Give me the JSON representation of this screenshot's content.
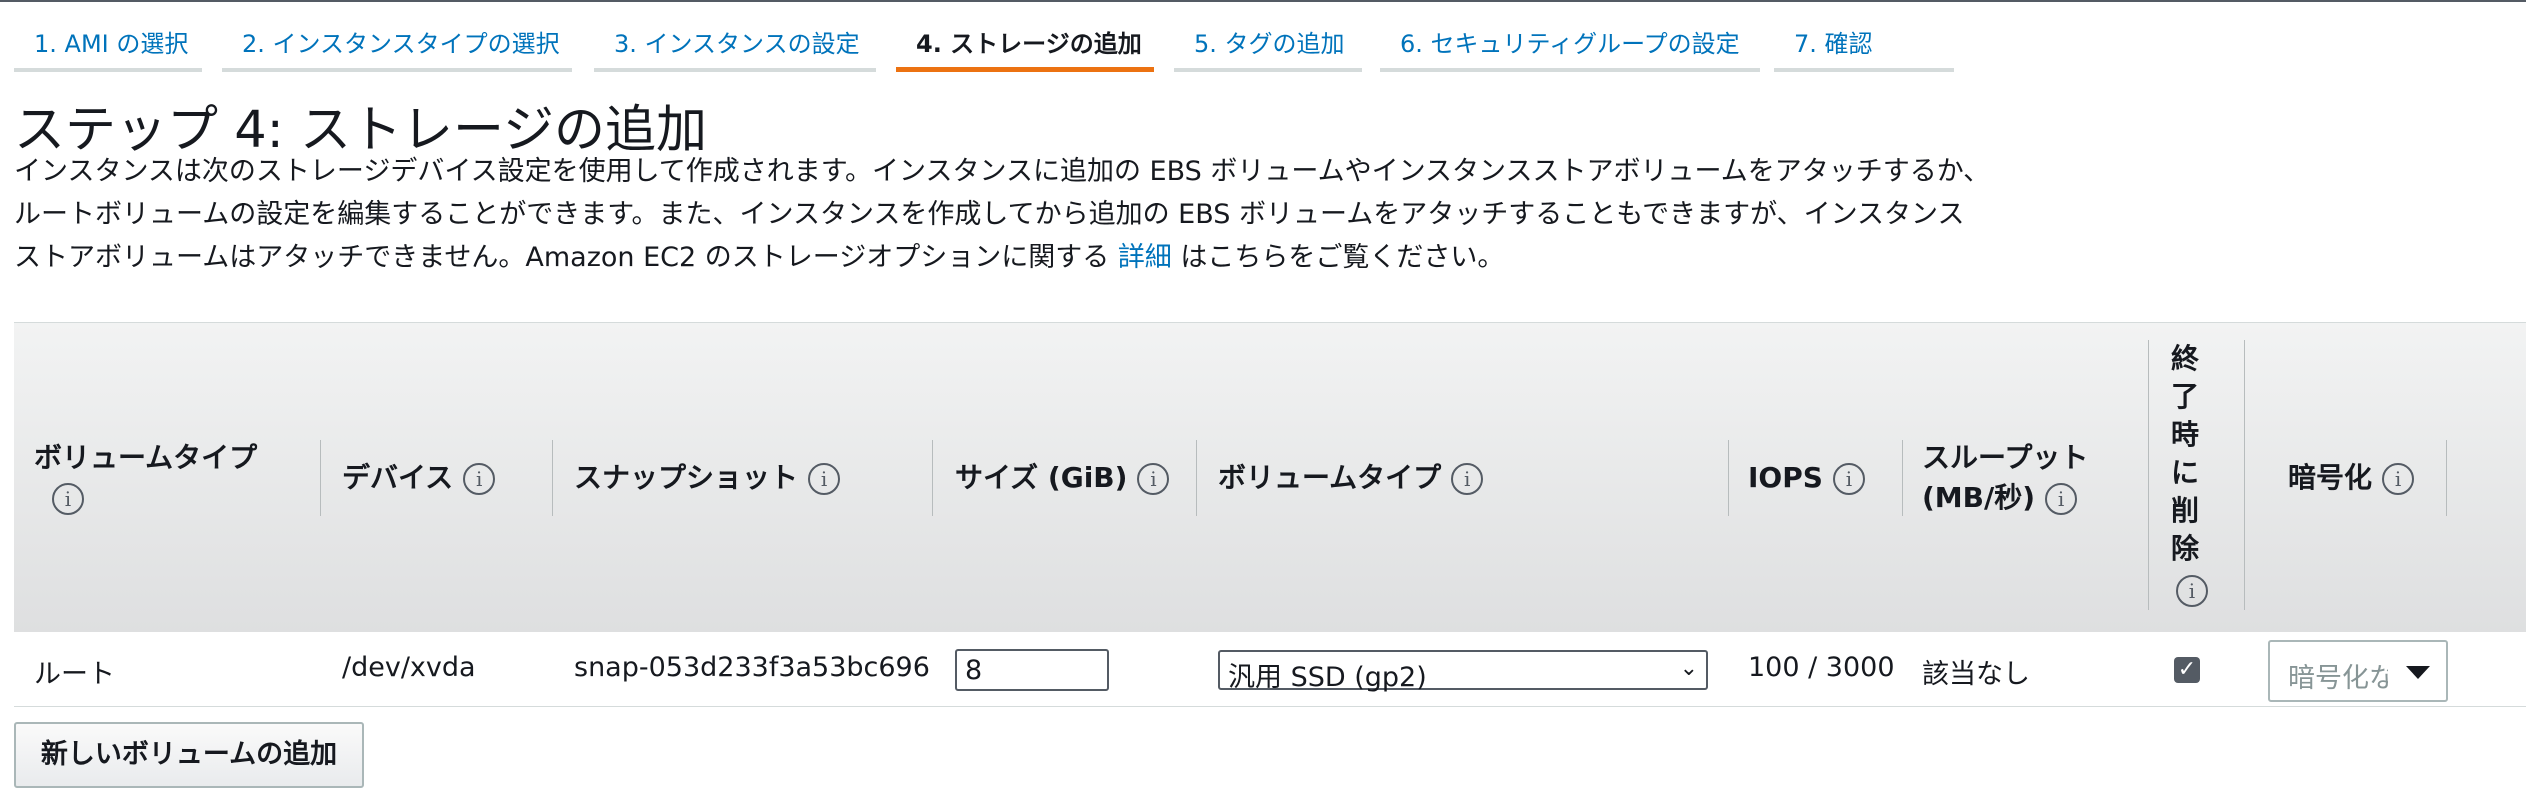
{
  "tabs": [
    {
      "label": "1. AMI の選択"
    },
    {
      "label": "2. インスタンスタイプの選択"
    },
    {
      "label": "3. インスタンスの設定"
    },
    {
      "label": "4. ストレージの追加"
    },
    {
      "label": "5. タグの追加"
    },
    {
      "label": "6. セキュリティグループの設定"
    },
    {
      "label": "7. 確認"
    }
  ],
  "active_tab": 3,
  "colors": {
    "accent": "#ec7211",
    "link": "#0073bb",
    "text": "#16191f"
  },
  "page": {
    "title": "ステップ 4: ストレージの追加",
    "desc_line1": "インスタンスは次のストレージデバイス設定を使用して作成されます。インスタンスに追加の EBS ボリュームやインスタンスストアボリュームをアタッチするか、",
    "desc_line2": "ルートボリュームの設定を編集することができます。また、インスタンスを作成してから追加の EBS ボリュームをアタッチすることもできますが、インスタンス",
    "desc_line3_pre": "ストアボリュームはアタッチできません。Amazon EC2 のストレージオプションに関する ",
    "desc_link": "詳細",
    "desc_line3_post": " はこちらをご覧ください。"
  },
  "table": {
    "headers": {
      "volume_type": "ボリュームタイプ",
      "device": "デバイス",
      "snapshot": "スナップショット",
      "size": "サイズ (GiB)",
      "vol_type2": "ボリュームタイプ",
      "iops": "IOPS",
      "throughput_1": "スループット",
      "throughput_2": "(MB/秒)",
      "delete_chars": [
        "終",
        "了",
        "時",
        "に",
        "削",
        "除"
      ],
      "encryption": "暗号化"
    },
    "info_icon": "i",
    "row": {
      "volume_type": "ルート",
      "device": "/dev/xvda",
      "snapshot": "snap-053d233f3a53bc696",
      "size": "8",
      "vol_type": "汎用 SSD (gp2)",
      "iops": "100 / 3000",
      "throughput": "該当なし",
      "delete_on_termination": true,
      "encryption_placeholder": "暗号化な"
    }
  },
  "add_volume_button": "新しいボリュームの追加"
}
